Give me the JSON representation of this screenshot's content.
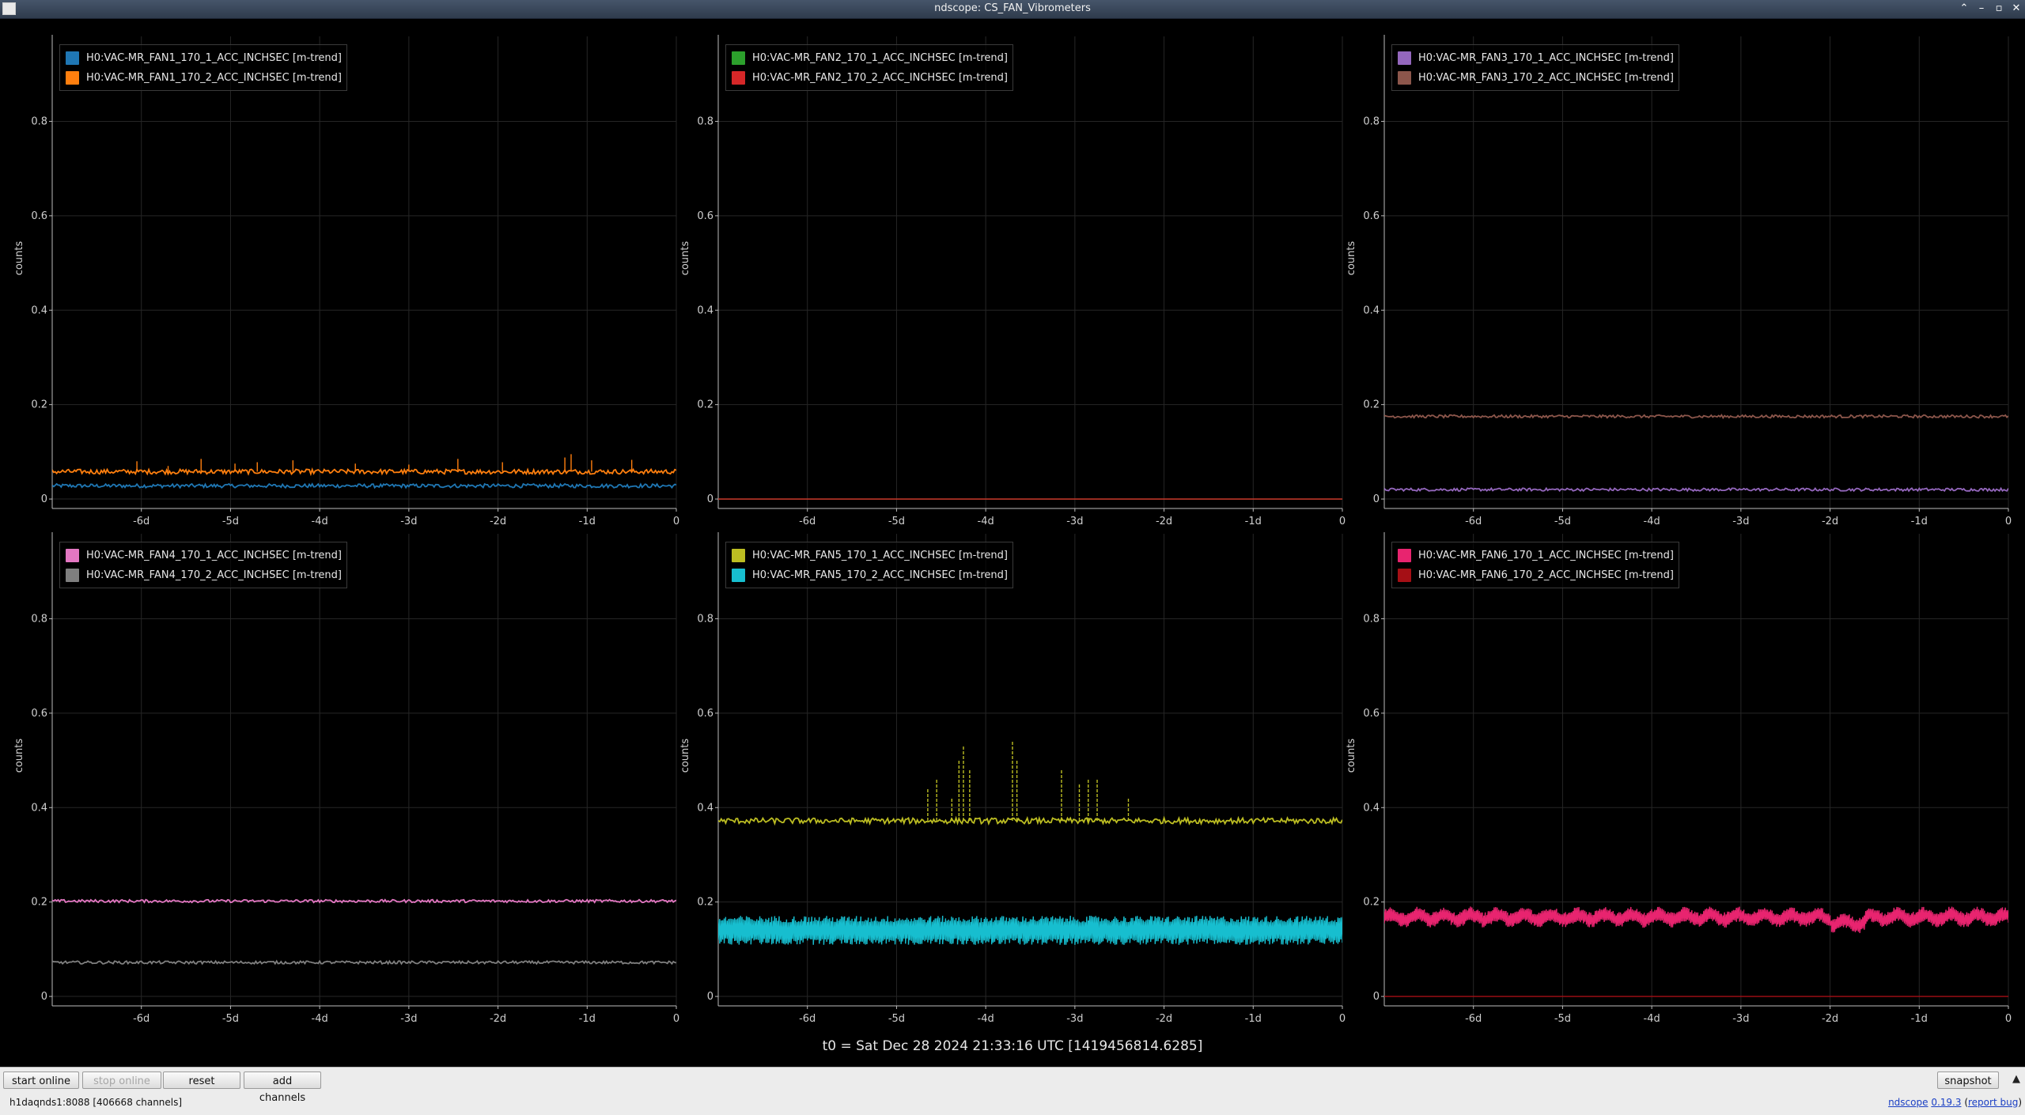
{
  "window": {
    "title": "ndscope: CS_FAN_Vibrometers"
  },
  "axes": {
    "ylabel": "counts",
    "y_ticks": [
      "0",
      "0.2",
      "0.4",
      "0.6",
      "0.8"
    ],
    "x_ticks": [
      "-6d",
      "-5d",
      "-4d",
      "-3d",
      "-2d",
      "-1d",
      "0"
    ]
  },
  "t0_label": "t0 = Sat Dec 28 2024 21:33:16 UTC [1419456814.6285]",
  "toolbar": {
    "start_online": "start online",
    "stop_online": "stop online",
    "reset": "reset",
    "add_channels": "add channels",
    "snapshot": "snapshot"
  },
  "status": {
    "server": "h1daqnds1:8088  [406668 channels]",
    "app_name": "ndscope",
    "version": "0.19.3",
    "report_bug": "report bug"
  },
  "chart_data": [
    {
      "type": "line",
      "ylabel": "counts",
      "xlim_days": [
        -7,
        0
      ],
      "ylim": [
        -0.02,
        0.98
      ],
      "grid": true,
      "legend_position": "top-left",
      "series": [
        {
          "name": "H0:VAC-MR_FAN1_170_1_ACC_INCHSEC [m-trend]",
          "color": "#1f77b4",
          "level": 0.028,
          "noise": 0.004,
          "spikes": []
        },
        {
          "name": "H0:VAC-MR_FAN1_170_2_ACC_INCHSEC [m-trend]",
          "color": "#ff7f0e",
          "level": 0.058,
          "noise": 0.005,
          "spikes": [
            {
              "x": -6.05,
              "v": 0.08
            },
            {
              "x": -5.7,
              "v": 0.07
            },
            {
              "x": -5.33,
              "v": 0.085
            },
            {
              "x": -4.95,
              "v": 0.075
            },
            {
              "x": -4.7,
              "v": 0.078
            },
            {
              "x": -4.3,
              "v": 0.082
            },
            {
              "x": -3.6,
              "v": 0.075
            },
            {
              "x": -3.0,
              "v": 0.073
            },
            {
              "x": -2.45,
              "v": 0.085
            },
            {
              "x": -1.95,
              "v": 0.078
            },
            {
              "x": -1.25,
              "v": 0.088
            },
            {
              "x": -1.18,
              "v": 0.095
            },
            {
              "x": -0.95,
              "v": 0.082
            },
            {
              "x": -0.5,
              "v": 0.083
            }
          ]
        }
      ]
    },
    {
      "type": "line",
      "ylabel": "counts",
      "xlim_days": [
        -7,
        0
      ],
      "ylim": [
        -0.02,
        0.98
      ],
      "grid": true,
      "legend_position": "top-left",
      "series": [
        {
          "name": "H0:VAC-MR_FAN2_170_1_ACC_INCHSEC [m-trend]",
          "color": "#2ca02c",
          "level": 0.0,
          "noise": 0.0,
          "spikes": []
        },
        {
          "name": "H0:VAC-MR_FAN2_170_2_ACC_INCHSEC [m-trend]",
          "color": "#d62728",
          "level": 0.0,
          "noise": 0.0,
          "spikes": []
        }
      ]
    },
    {
      "type": "line",
      "ylabel": "counts",
      "xlim_days": [
        -7,
        0
      ],
      "ylim": [
        -0.02,
        0.98
      ],
      "grid": true,
      "legend_position": "top-left",
      "series": [
        {
          "name": "H0:VAC-MR_FAN3_170_1_ACC_INCHSEC [m-trend]",
          "color": "#9467bd",
          "level": 0.02,
          "noise": 0.003,
          "spikes": []
        },
        {
          "name": "H0:VAC-MR_FAN3_170_2_ACC_INCHSEC [m-trend]",
          "color": "#8c564b",
          "level": 0.175,
          "noise": 0.003,
          "spikes": []
        }
      ]
    },
    {
      "type": "line",
      "ylabel": "counts",
      "xlim_days": [
        -7,
        0
      ],
      "ylim": [
        -0.02,
        0.98
      ],
      "grid": true,
      "legend_position": "top-left",
      "series": [
        {
          "name": "H0:VAC-MR_FAN4_170_1_ACC_INCHSEC [m-trend]",
          "color": "#e377c2",
          "level": 0.202,
          "noise": 0.003,
          "spikes": []
        },
        {
          "name": "H0:VAC-MR_FAN4_170_2_ACC_INCHSEC [m-trend]",
          "color": "#7f7f7f",
          "level": 0.072,
          "noise": 0.003,
          "spikes": []
        }
      ]
    },
    {
      "type": "line",
      "ylabel": "counts",
      "xlim_days": [
        -7,
        0
      ],
      "ylim": [
        -0.02,
        0.98
      ],
      "grid": true,
      "legend_position": "top-left",
      "series": [
        {
          "name": "H0:VAC-MR_FAN5_170_1_ACC_INCHSEC [m-trend]",
          "color": "#bcbd22",
          "level": 0.372,
          "noise": 0.006,
          "spikes": [
            {
              "x": -4.65,
              "v": 0.44
            },
            {
              "x": -4.55,
              "v": 0.46
            },
            {
              "x": -4.38,
              "v": 0.42
            },
            {
              "x": -4.3,
              "v": 0.5
            },
            {
              "x": -4.25,
              "v": 0.53
            },
            {
              "x": -4.18,
              "v": 0.48
            },
            {
              "x": -3.7,
              "v": 0.54
            },
            {
              "x": -3.65,
              "v": 0.5
            },
            {
              "x": -3.15,
              "v": 0.48
            },
            {
              "x": -2.95,
              "v": 0.45
            },
            {
              "x": -2.85,
              "v": 0.46
            },
            {
              "x": -2.75,
              "v": 0.46
            },
            {
              "x": -2.4,
              "v": 0.42
            }
          ]
        },
        {
          "name": "H0:VAC-MR_FAN5_170_2_ACC_INCHSEC [m-trend]",
          "color": "#17becf",
          "level": 0.14,
          "noise": 0.028,
          "spikes": []
        }
      ]
    },
    {
      "type": "line",
      "ylabel": "counts",
      "xlim_days": [
        -7,
        0
      ],
      "ylim": [
        -0.02,
        0.98
      ],
      "grid": true,
      "legend_position": "top-left",
      "series": [
        {
          "name": "H0:VAC-MR_FAN6_170_1_ACC_INCHSEC [m-trend]",
          "color": "#e8246f",
          "level": 0.168,
          "noise": 0.015,
          "spikes": []
        },
        {
          "name": "H0:VAC-MR_FAN6_170_2_ACC_INCHSEC [m-trend]",
          "color": "#a50f15",
          "level": 0.0,
          "noise": 0.0,
          "spikes": []
        }
      ]
    }
  ]
}
